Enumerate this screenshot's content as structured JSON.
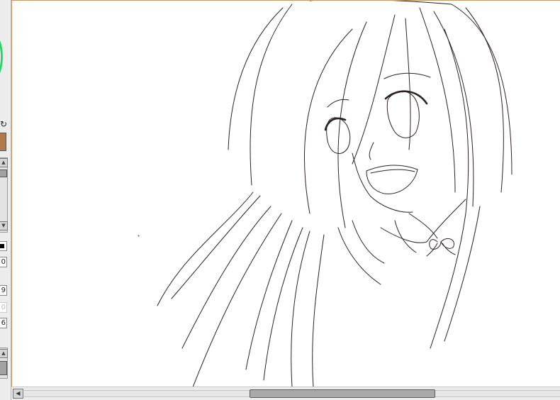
{
  "tool_panel": {
    "icons": {
      "color_wheel": "color-wheel-icon",
      "swap": "swap-colors-icon",
      "scroll_up": "up-arrow-icon",
      "scroll_down": "down-arrow-icon",
      "scroll_left": "left-arrow-icon"
    },
    "swap_glyph": "↻",
    "main_color": "#b07a4a",
    "secondary_color": "#000000",
    "wheel_ring_color": "#2ad46c",
    "values": [
      {
        "text": "0",
        "enabled": true
      },
      {
        "text": "9",
        "enabled": true
      },
      {
        "text": "0",
        "enabled": false
      },
      {
        "text": "6",
        "enabled": true
      }
    ]
  },
  "canvas": {
    "background": "#ffffff",
    "line_color": "#2b2221",
    "frame_color": "#c89a6a",
    "horizontal_scroll_fraction": 0.33
  },
  "arrows": {
    "up": "▲",
    "down": "▼",
    "left": "◀"
  }
}
